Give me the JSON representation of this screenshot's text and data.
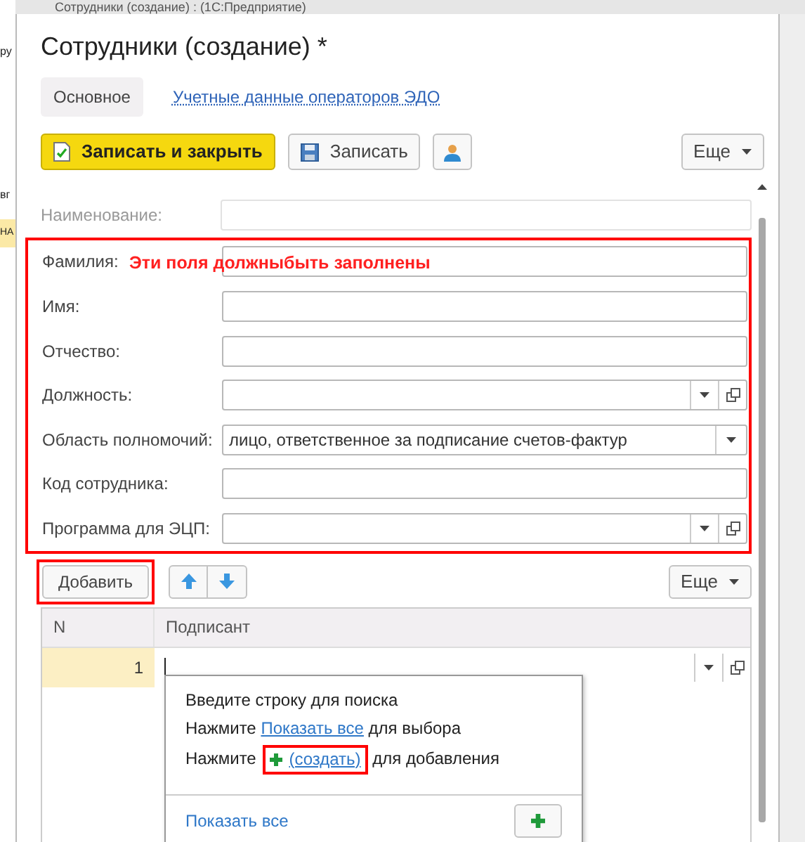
{
  "window": {
    "title": "Сотрудники (создание) : (1С:Предприятие)"
  },
  "background_fragments": [
    "ру",
    "вг",
    "НА"
  ],
  "form": {
    "title": "Сотрудники (создание) *",
    "tabs": [
      {
        "label": "Основное",
        "selected": true
      },
      {
        "label": "Учетные данные операторов ЭДО",
        "selected": false
      }
    ],
    "toolbar": [
      {
        "kind": "primary",
        "label": "Записать и закрыть"
      },
      {
        "kind": "save",
        "label": "Записать"
      },
      {
        "kind": "person"
      },
      {
        "kind": "more",
        "label": "Еще"
      }
    ],
    "fields": [
      {
        "label": "Наименование:",
        "kind": "text",
        "disabled": true
      }
    ],
    "highlighted_fields": [
      {
        "label": "Фамилия:",
        "kind": "text",
        "disabled": false,
        "note": "Эти поля должныбыть заполнены"
      },
      {
        "label": "Имя:",
        "kind": "text",
        "disabled": false
      },
      {
        "label": "Отчество:",
        "kind": "text",
        "disabled": false
      },
      {
        "label": "Должность:",
        "kind": "select_open",
        "disabled": false
      },
      {
        "label": "Область полномочий:",
        "kind": "select",
        "disabled": false,
        "value": "лицо, ответственное за подписание счетов-фактур"
      },
      {
        "label": "Код сотрудника:",
        "kind": "text",
        "disabled": false
      },
      {
        "label": "Программа для ЭЦП:",
        "kind": "select_open",
        "disabled": false
      }
    ],
    "table_toolbar": {
      "add": {
        "label": "Добавить",
        "highlighted": true
      },
      "more": "Еще"
    },
    "table": {
      "columns": [
        "N",
        "Подписант"
      ],
      "rows": [
        {
          "n": "1",
          "selected": true,
          "editing": true
        }
      ]
    },
    "dropdown": {
      "hint": "Введите строку для поиска",
      "line_show": {
        "before": "Нажмите ",
        "link": "Показать все",
        "after": " для выбора"
      },
      "line_create": {
        "before": "Нажмите ",
        "link": "(создать)",
        "after": " для добавления",
        "highlighted": true
      },
      "footer_link": "Показать все"
    }
  }
}
